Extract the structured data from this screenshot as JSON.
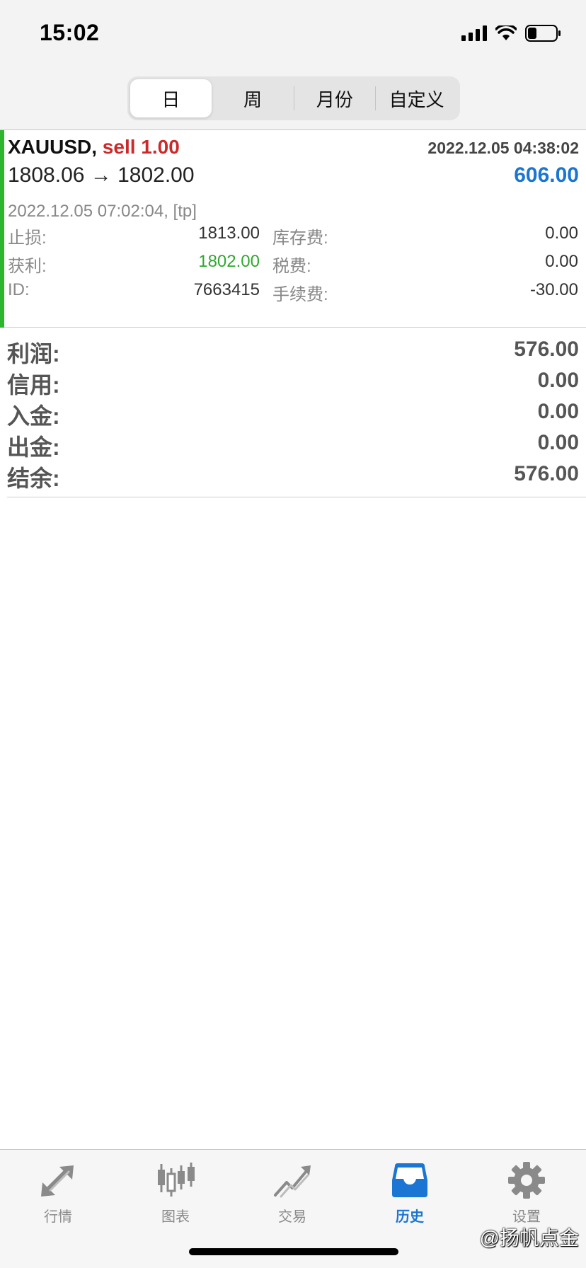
{
  "status_bar": {
    "time": "15:02"
  },
  "segments": [
    {
      "label": "日",
      "active": true
    },
    {
      "label": "周",
      "active": false
    },
    {
      "label": "月份",
      "active": false
    },
    {
      "label": "自定义",
      "active": false
    }
  ],
  "trade": {
    "symbol": "XAUUSD,",
    "side": "sell 1.00",
    "open_time": "2022.12.05 04:38:02",
    "prices": "1808.06 → 1802.00",
    "profit": "606.00",
    "close_info": "2022.12.05 07:02:04, [tp]",
    "details": [
      {
        "label1": "止损:",
        "value1": "1813.00",
        "label2": "库存费:",
        "value2": "0.00"
      },
      {
        "label1": "获利:",
        "value1": "1802.00",
        "label2": "税费:",
        "value2": "0.00"
      },
      {
        "label1": "ID:",
        "value1": "7663415",
        "label2": "手续费:",
        "value2": "-30.00"
      }
    ]
  },
  "summary": [
    {
      "label": "利润:",
      "value": "576.00"
    },
    {
      "label": "信用:",
      "value": "0.00"
    },
    {
      "label": "入金:",
      "value": "0.00"
    },
    {
      "label": "出金:",
      "value": "0.00"
    },
    {
      "label": "结余:",
      "value": "576.00"
    }
  ],
  "tabs": [
    {
      "label": "行情",
      "icon": "quotes-arrows-icon",
      "active": false
    },
    {
      "label": "图表",
      "icon": "candlestick-chart-icon",
      "active": false
    },
    {
      "label": "交易",
      "icon": "trade-chart-icon",
      "active": false
    },
    {
      "label": "历史",
      "icon": "history-inbox-icon",
      "active": true
    },
    {
      "label": "设置",
      "icon": "gear-icon",
      "active": false
    }
  ],
  "watermark": "@扬帆点金",
  "colors": {
    "accent": "#1a76d2",
    "sell": "#cc2a2a",
    "profit_green": "#2fa82f",
    "bar_green": "#2db52d"
  }
}
